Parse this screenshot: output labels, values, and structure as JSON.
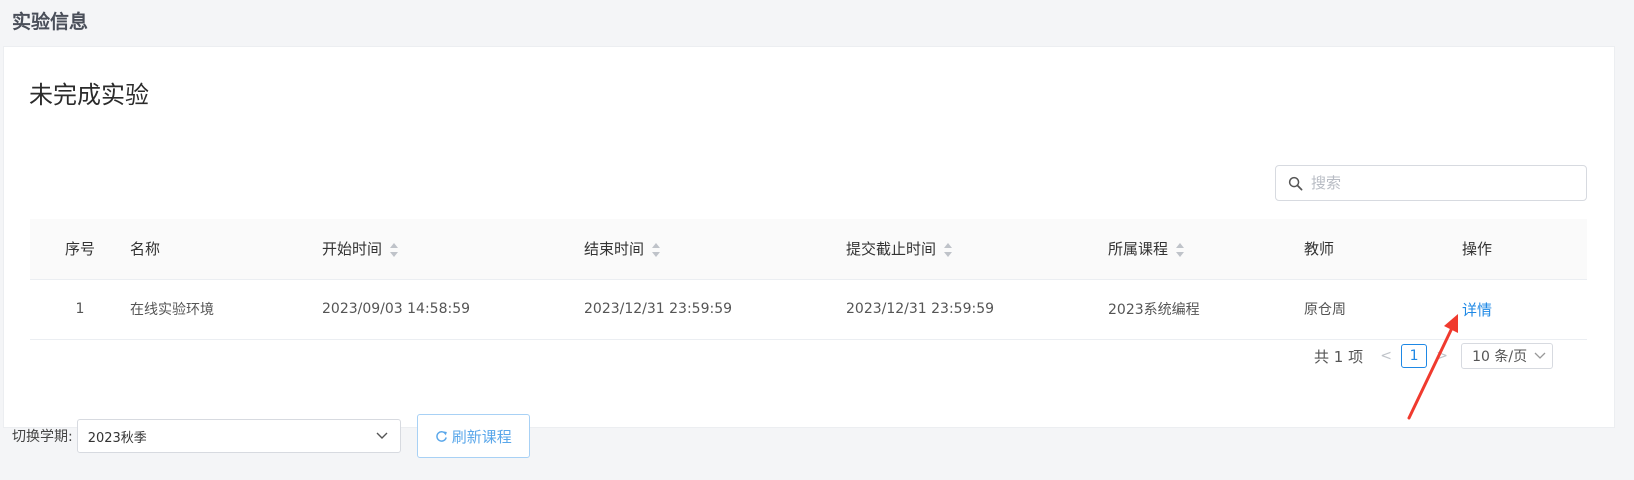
{
  "page": {
    "title": "实验信息"
  },
  "card": {
    "title": "未完成实验"
  },
  "search": {
    "placeholder": "搜索"
  },
  "table": {
    "headers": {
      "index": "序号",
      "name": "名称",
      "start_time": "开始时间",
      "end_time": "结束时间",
      "deadline": "提交截止时间",
      "course": "所属课程",
      "teacher": "教师",
      "action": "操作"
    },
    "rows": [
      {
        "index": "1",
        "name": "在线实验环境",
        "start_time": "2023/09/03 14:58:59",
        "end_time": "2023/12/31 23:59:59",
        "deadline": "2023/12/31 23:59:59",
        "course": "2023系统编程",
        "teacher": "原仓周",
        "action": "详情"
      }
    ]
  },
  "pagination": {
    "total": "共 1 项",
    "prev": "<",
    "current": "1",
    "next": ">",
    "page_size": "10 条/页"
  },
  "footer": {
    "semester_label": "切换学期:",
    "semester_value": "2023秋季",
    "refresh_label": "刷新课程"
  },
  "colors": {
    "link": "#1e88e5",
    "annotation_arrow": "#f03a2e",
    "background": "#f4f5f7"
  }
}
